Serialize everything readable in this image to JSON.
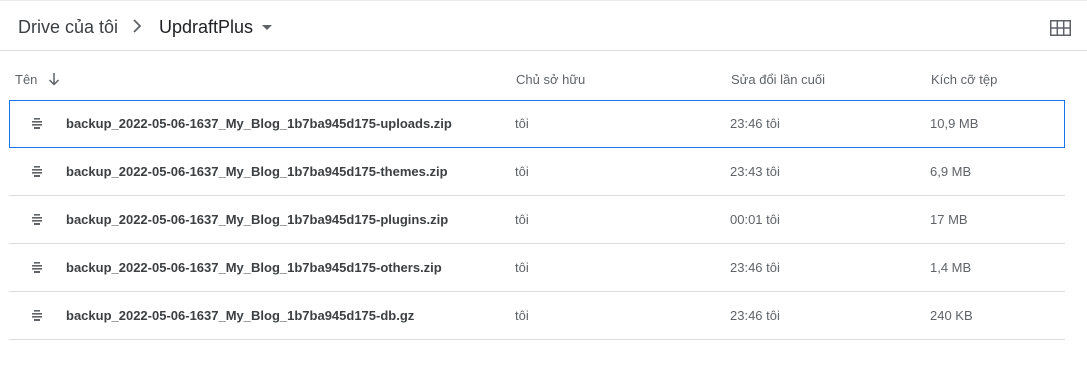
{
  "breadcrumb": {
    "root": "Drive của tôi",
    "current": "UpdraftPlus"
  },
  "view_toggle": {
    "icon": "grid-view-icon"
  },
  "columns": {
    "name": "Tên",
    "owner": "Chủ sở hữu",
    "modified": "Sửa đổi lần cuối",
    "size": "Kích cỡ tệp"
  },
  "files": [
    {
      "name": "backup_2022-05-06-1637_My_Blog_1b7ba945d175-uploads.zip",
      "owner": "tôi",
      "modified": "23:46  tôi",
      "size": "10,9 MB",
      "selected": true
    },
    {
      "name": "backup_2022-05-06-1637_My_Blog_1b7ba945d175-themes.zip",
      "owner": "tôi",
      "modified": "23:43  tôi",
      "size": "6,9 MB",
      "selected": false
    },
    {
      "name": "backup_2022-05-06-1637_My_Blog_1b7ba945d175-plugins.zip",
      "owner": "tôi",
      "modified": "00:01  tôi",
      "size": "17 MB",
      "selected": false
    },
    {
      "name": "backup_2022-05-06-1637_My_Blog_1b7ba945d175-others.zip",
      "owner": "tôi",
      "modified": "23:46  tôi",
      "size": "1,4 MB",
      "selected": false
    },
    {
      "name": "backup_2022-05-06-1637_My_Blog_1b7ba945d175-db.gz",
      "owner": "tôi",
      "modified": "23:46  tôi",
      "size": "240 KB",
      "selected": false
    }
  ],
  "colors": {
    "selection_border": "#1a73e8",
    "divider": "#dadce0",
    "icon": "#5f6368"
  }
}
